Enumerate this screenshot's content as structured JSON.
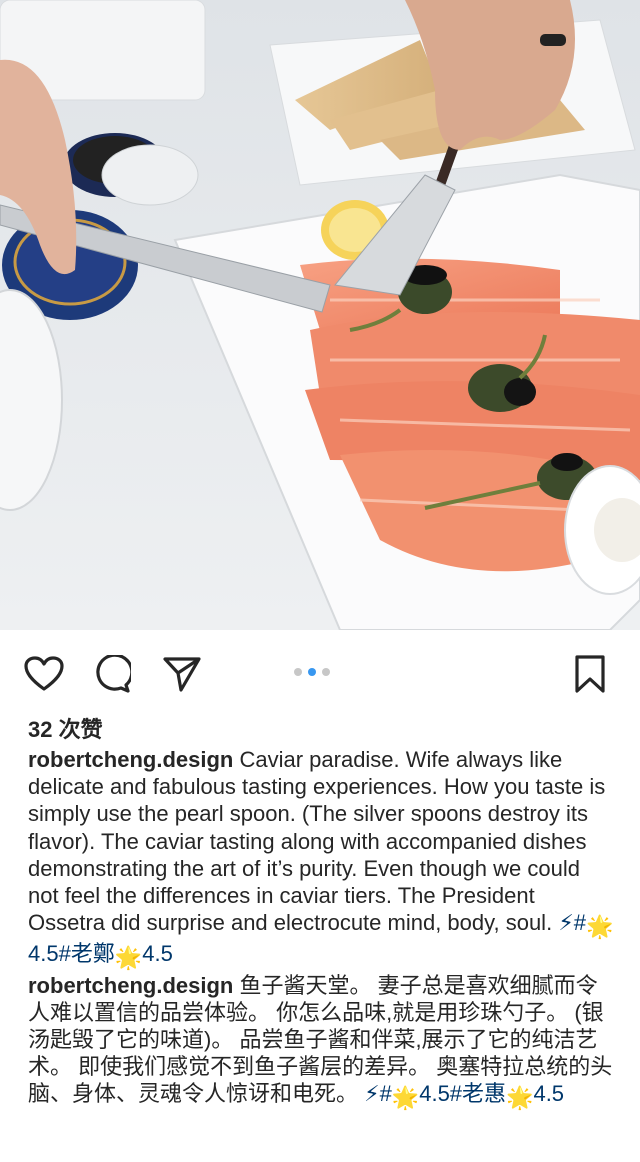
{
  "post": {
    "photo_alt": "Smoked salmon with caviar, capers and lemon"
  },
  "actions": {
    "like_icon": "heart-icon",
    "comment_icon": "comment-icon",
    "share_icon": "paper-plane-icon",
    "save_icon": "bookmark-icon",
    "carousel_total": 3,
    "carousel_active": 2
  },
  "likes": {
    "text": "32 次赞"
  },
  "caption_en": {
    "username": "robertcheng.design",
    "text": " Caviar paradise. Wife always like delicate and fabulous tasting experiences. How you taste is simply use the pearl spoon. (The silver spoons destroy its flavor). The caviar tasting along with accompanied dishes demonstrating the art of it’s purity. Even though we could not feel the differences in caviar tiers. The President Ossetra did surprise and electrocute mind, body, soul. ",
    "tag1": "⚡#",
    "star1": "🌟",
    "tag2": "4.5#老鄭",
    "star2": "🌟",
    "tag3": "4.5"
  },
  "caption_cn": {
    "username": "robertcheng.design",
    "text": " 鱼子酱天堂。 妻子总是喜欢细腻而令人难以置信的品尝体验。 你怎么品味,就是用珍珠勺子。 (银汤匙毁了它的味道)。 品尝鱼子酱和伴菜,展示了它的纯洁艺术。 即使我们感觉不到鱼子酱层的差异。 奥塞特拉总统的头脑、身体、灵魂令人惊讶和电死。 ",
    "tag1": "⚡#",
    "star1": "🌟",
    "tag2": "4.5#老惠",
    "star2": "🌟",
    "tag3": "4.5"
  },
  "colors": {
    "text": "#262626",
    "link": "#00376b",
    "carousel_active": "#3897f0",
    "carousel_inactive": "#c7c7c7",
    "salmon": "#f0866a"
  }
}
